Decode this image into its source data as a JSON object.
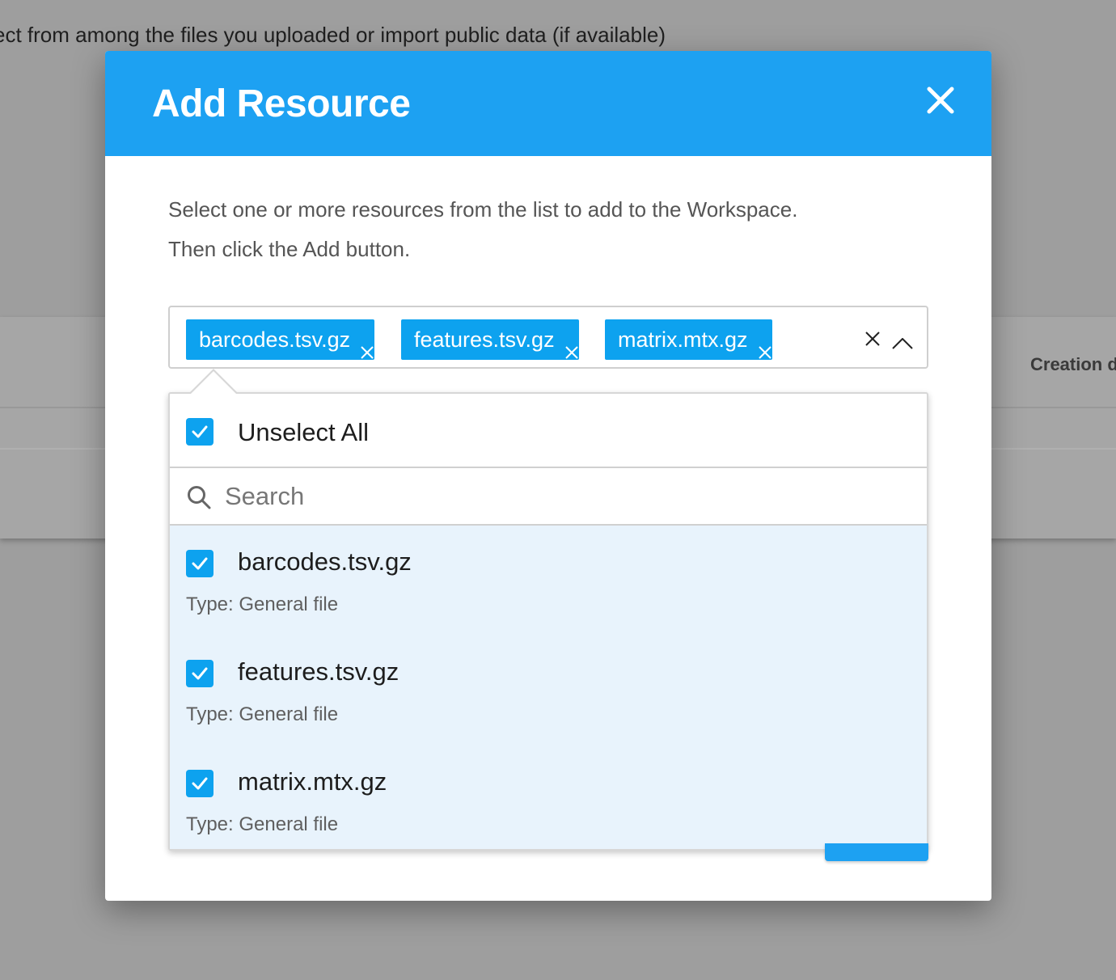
{
  "background": {
    "instruction_text": "ect from among the files you uploaded or import public data (if available)",
    "column_header": "Creation d"
  },
  "modal": {
    "title": "Add Resource",
    "instructions_line1": "Select one or more resources from the list to add to the Workspace.",
    "instructions_line2": "Then click the Add button."
  },
  "multiselect": {
    "chips": [
      "barcodes.tsv.gz",
      "features.tsv.gz",
      "matrix.mtx.gz"
    ],
    "dropdown": {
      "unselect_all_label": "Unselect All",
      "search_placeholder": "Search",
      "search_value": "",
      "options": [
        {
          "name": "barcodes.tsv.gz",
          "type": "Type: General file",
          "checked": true
        },
        {
          "name": "features.tsv.gz",
          "type": "Type: General file",
          "checked": true
        },
        {
          "name": "matrix.mtx.gz",
          "type": "Type: General file",
          "checked": true
        }
      ]
    }
  },
  "colors": {
    "header_blue": "#1da1f2",
    "chip_blue": "#0da2ef",
    "option_selected_bg": "#e8f3fc",
    "overlay_gray": "#9e9e9e"
  },
  "icons": {
    "close": "close-icon",
    "chip_remove": "x-icon",
    "clear": "clear-icon",
    "toggle": "chevron-up-icon",
    "search": "search-icon",
    "check": "check-icon"
  }
}
